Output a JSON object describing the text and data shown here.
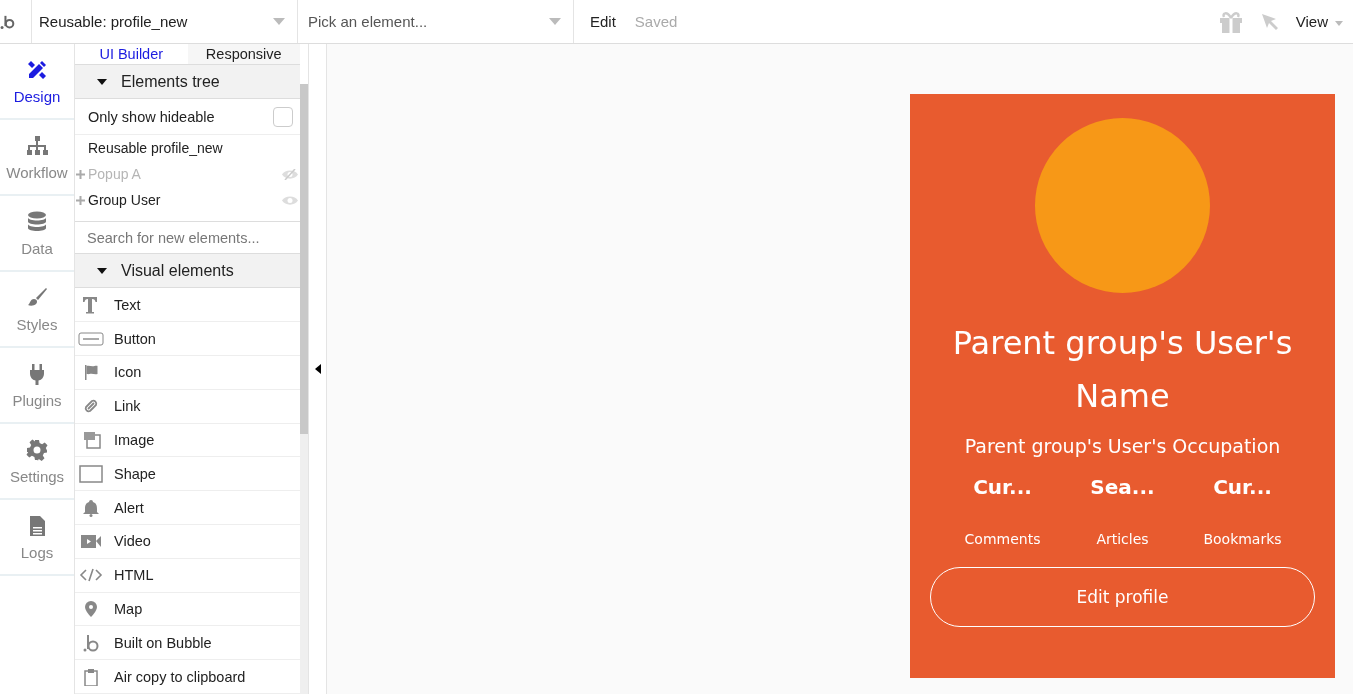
{
  "topbar": {
    "page_dropdown": {
      "value": "Reusable: profile_new"
    },
    "element_dropdown": {
      "placeholder": "Pick an element..."
    },
    "edit_label": "Edit",
    "save_status": "Saved",
    "view_menu": "View"
  },
  "nav": [
    {
      "label": "Design",
      "selected": true
    },
    {
      "label": "Workflow",
      "selected": false
    },
    {
      "label": "Data",
      "selected": false
    },
    {
      "label": "Styles",
      "selected": false
    },
    {
      "label": "Plugins",
      "selected": false
    },
    {
      "label": "Settings",
      "selected": false
    },
    {
      "label": "Logs",
      "selected": false
    }
  ],
  "panel": {
    "tabs": [
      {
        "label": "UI Builder",
        "selected": true
      },
      {
        "label": "Responsive",
        "selected": false
      }
    ],
    "elements_tree": {
      "title": "Elements tree",
      "expanded": true,
      "only_hideable": {
        "label": "Only show hideable",
        "checked": false
      },
      "root": "Reusable profile_new",
      "children": [
        {
          "label": "Popup A",
          "hidden": true
        },
        {
          "label": "Group User",
          "hidden": false
        }
      ]
    },
    "search": {
      "placeholder": "Search for new elements..."
    },
    "visual_elements": {
      "title": "Visual elements",
      "expanded": true,
      "items": [
        {
          "label": "Text"
        },
        {
          "label": "Button"
        },
        {
          "label": "Icon"
        },
        {
          "label": "Link"
        },
        {
          "label": "Image"
        },
        {
          "label": "Shape"
        },
        {
          "label": "Alert"
        },
        {
          "label": "Video"
        },
        {
          "label": "HTML"
        },
        {
          "label": "Map"
        },
        {
          "label": "Built on Bubble"
        },
        {
          "label": "Air copy to clipboard"
        }
      ]
    }
  },
  "card": {
    "name": "Parent group's User's Name",
    "occupation": "Parent group's User's Occupation",
    "stats": [
      {
        "value": "Cur...",
        "label": "Comments"
      },
      {
        "value": "Sea...",
        "label": "Articles"
      },
      {
        "value": "Cur...",
        "label": "Bookmarks"
      }
    ],
    "button": "Edit profile"
  }
}
